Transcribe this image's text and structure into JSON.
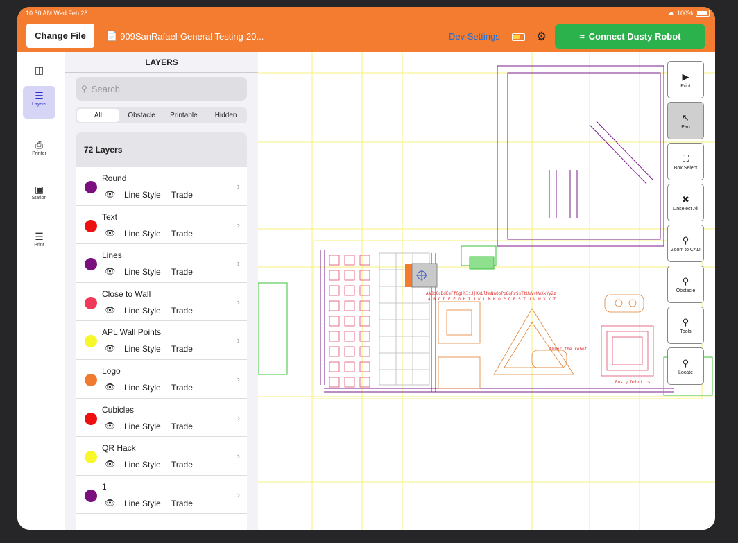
{
  "status": {
    "time": "10:50 AM  Wed Feb 28",
    "battery": "100%"
  },
  "header": {
    "change_file": "Change File",
    "file_name": "909SanRafael-General Testing-20...",
    "dev_settings": "Dev Settings",
    "connect": "Connect Dusty Robot"
  },
  "rail": [
    {
      "label": "",
      "icon": "sidebar-toggle-icon"
    },
    {
      "label": "Layers",
      "icon": "layers-icon"
    },
    {
      "label": "Printer",
      "icon": "printer-icon"
    },
    {
      "label": "Station",
      "icon": "station-icon"
    },
    {
      "label": "Print",
      "icon": "print-list-icon"
    }
  ],
  "panel": {
    "title": "LAYERS",
    "search_placeholder": "Search",
    "filters": [
      "All",
      "Obstacle",
      "Printable",
      "Hidden"
    ],
    "count": "72 Layers",
    "layers": [
      {
        "name": "Round",
        "color": "#7b0f7e",
        "line_style": "Line Style",
        "trade": "Trade"
      },
      {
        "name": "Text",
        "color": "#ee1010",
        "line_style": "Line Style",
        "trade": "Trade"
      },
      {
        "name": "Lines",
        "color": "#7b0f7e",
        "line_style": "Line Style",
        "trade": "Trade"
      },
      {
        "name": "Close to Wall",
        "color": "#f0385a",
        "line_style": "Line Style",
        "trade": "Trade"
      },
      {
        "name": "APL Wall Points",
        "color": "#f7f72a",
        "line_style": "Line Style",
        "trade": "Trade"
      },
      {
        "name": "Logo",
        "color": "#f07a30",
        "line_style": "Line Style",
        "trade": "Trade"
      },
      {
        "name": "Cubicles",
        "color": "#ee1010",
        "line_style": "Line Style",
        "trade": "Trade"
      },
      {
        "name": "QR Hack",
        "color": "#f7f72a",
        "line_style": "Line Style",
        "trade": "Trade"
      },
      {
        "name": "1",
        "color": "#7b0f7e",
        "line_style": "Line Style",
        "trade": "Trade"
      }
    ]
  },
  "tools": [
    {
      "label": "Print",
      "icon": "play-icon"
    },
    {
      "label": "Pan",
      "icon": "cursor-icon"
    },
    {
      "label": "Box Select",
      "icon": "box-select-icon"
    },
    {
      "label": "Unselect All",
      "icon": "unselect-icon"
    },
    {
      "label": "Zoom to CAD",
      "icon": "zoom-icon"
    },
    {
      "label": "Obstacle",
      "icon": "zoom-icon"
    },
    {
      "label": "Tools",
      "icon": "zoom-icon"
    },
    {
      "label": "Locate",
      "icon": "zoom-icon"
    }
  ],
  "cad_text": [
    "AaBbCcDdEeFfGgHhIiJjKkLlMmNnOoPpQqRrSsTtUuVvWwXxYyZz",
    "A B C D E F G H I J K L M N O P Q R S T U V W X Y Z",
    "Amber the robot",
    "Rusty Dobotics"
  ]
}
